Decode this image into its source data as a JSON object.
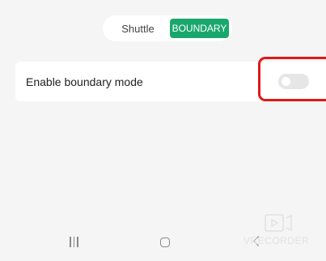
{
  "mode_toggle": {
    "options": [
      "Shuttle",
      "BOUNDARY"
    ],
    "selected": "BOUNDARY"
  },
  "settings": {
    "boundary_mode": {
      "label": "Enable boundary mode",
      "enabled": false
    }
  },
  "watermark": {
    "text": "VRECORDER"
  },
  "colors": {
    "accent": "#1aa76c",
    "highlight": "#e01818",
    "background": "#f5f5f5"
  },
  "icons": [
    "recents-icon",
    "home-icon",
    "back-icon",
    "recorder-watermark-icon"
  ]
}
